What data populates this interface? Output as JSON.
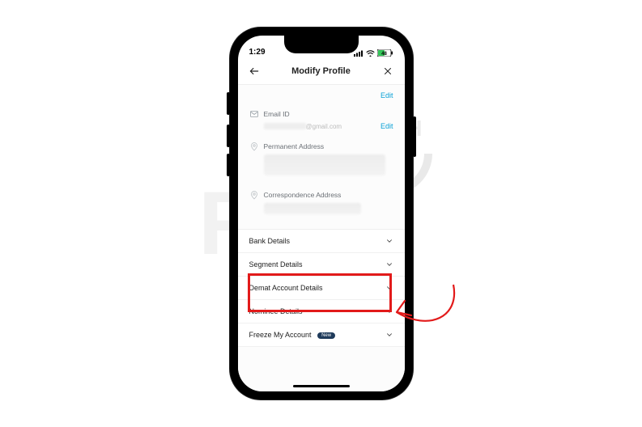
{
  "status": {
    "time": "1:29",
    "battery": "48"
  },
  "header": {
    "title": "Modify Profile"
  },
  "top_edit": "Edit",
  "email": {
    "label": "Email ID",
    "domain": "@gmail.com",
    "edit": "Edit"
  },
  "permanent_address": {
    "label": "Permanent Address"
  },
  "correspondence_address": {
    "label": "Correspondence Address"
  },
  "accordion": {
    "bank": "Bank Details",
    "segment": "Segment Details",
    "demat": "Demat Account Details",
    "nominee": "Nominee Details",
    "freeze": "Freeze My Account",
    "freeze_badge": "New"
  }
}
